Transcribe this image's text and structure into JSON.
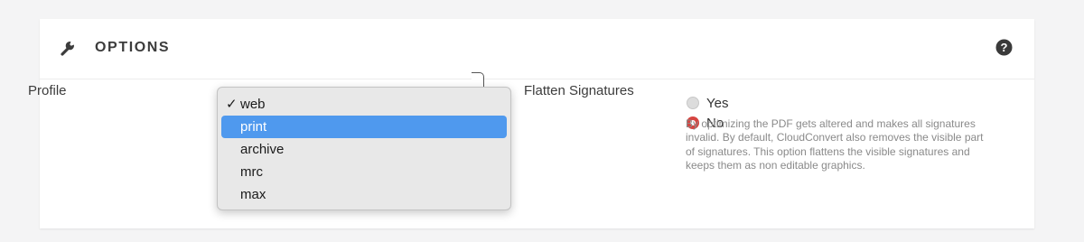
{
  "panel": {
    "title": "OPTIONS"
  },
  "profile": {
    "label": "Profile",
    "options": [
      {
        "label": "web",
        "selected": true
      },
      {
        "label": "print",
        "highlighted": true
      },
      {
        "label": "archive"
      },
      {
        "label": "mrc"
      },
      {
        "label": "max"
      }
    ],
    "check_mark": "✓"
  },
  "flatten_signatures": {
    "label": "Flatten Signatures",
    "options": [
      {
        "label": "Yes",
        "checked": false
      },
      {
        "label": "No",
        "checked": true
      }
    ],
    "help": "By optimizing the PDF gets altered and makes all signatures invalid. By default, CloudConvert also removes the visible part of signatures. This option flattens the visible signatures and keeps them as non editable graphics."
  },
  "colors": {
    "accent_red": "#d64541",
    "highlight_blue": "#4f99ee"
  }
}
